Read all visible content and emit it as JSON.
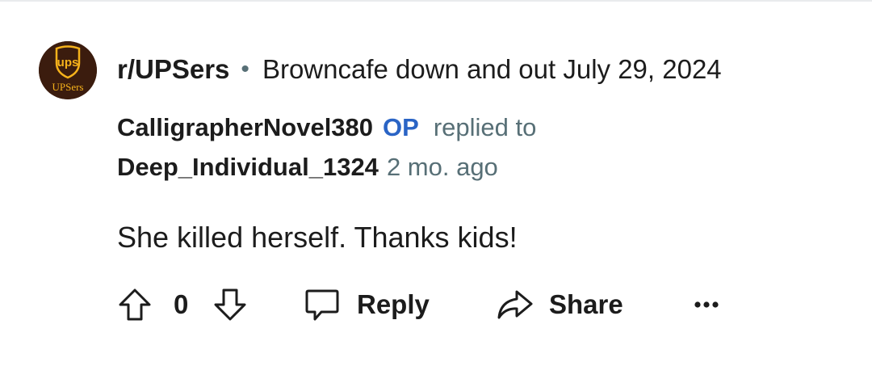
{
  "post": {
    "subreddit": "r/UPSers",
    "separator": "•",
    "title": "Browncafe down and out July 29, 2024"
  },
  "avatar": {
    "logo_text": "ups",
    "caption": "UPSers",
    "bg_color": "#3b1c0e",
    "accent_color": "#f6b21b"
  },
  "comment": {
    "author": "CalligrapherNovel380",
    "op_badge": "OP",
    "replied_to_label": "replied to",
    "replied_to_user": "Deep_Individual_1324",
    "timestamp": "2 mo. ago",
    "body": "She killed herself. Thanks kids!"
  },
  "actions": {
    "vote_count": "0",
    "reply_label": "Reply",
    "share_label": "Share",
    "more_icon": "ellipsis-icon",
    "upvote_icon": "arrow-up-icon",
    "downvote_icon": "arrow-down-icon",
    "reply_icon": "speech-bubble-icon",
    "share_icon": "share-arrow-icon"
  },
  "colors": {
    "text": "#1c1c1c",
    "muted": "#576f76",
    "op_blue": "#2a64c5"
  }
}
